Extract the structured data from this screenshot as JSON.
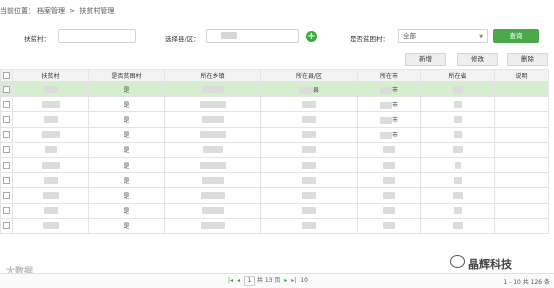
{
  "breadcrumb": {
    "prefix": "当前位置：",
    "item1": "档案管理",
    "sep": ">",
    "item2": "扶贫村管理"
  },
  "filters": {
    "village_label": "扶贫村：",
    "village_value": "",
    "county_label": "选择县/区：",
    "poor_label": "是否贫困村：",
    "poor_value": "全部",
    "search_label": "查询"
  },
  "toolbar": {
    "add": "新增",
    "edit": "修改",
    "delete": "删除"
  },
  "table": {
    "headers": [
      "扶贫村",
      "是否贫困村",
      "所在乡镇",
      "所在县/区",
      "所在市",
      "所在省",
      "说明"
    ],
    "rows": [
      {
        "poor": "是",
        "county_suffix": "县",
        "city_suffix": "市"
      },
      {
        "poor": "是",
        "county_suffix": "",
        "city_suffix": "市"
      },
      {
        "poor": "是",
        "county_suffix": "",
        "city_suffix": "市"
      },
      {
        "poor": "是",
        "county_suffix": "",
        "city_suffix": "市"
      },
      {
        "poor": "是",
        "county_suffix": "",
        "city_suffix": ""
      },
      {
        "poor": "是",
        "county_suffix": "",
        "city_suffix": ""
      },
      {
        "poor": "是",
        "county_suffix": "",
        "city_suffix": ""
      },
      {
        "poor": "是",
        "county_suffix": "",
        "city_suffix": ""
      },
      {
        "poor": "是",
        "county_suffix": "",
        "city_suffix": ""
      },
      {
        "poor": "是",
        "county_suffix": "",
        "city_suffix": ""
      }
    ]
  },
  "footer": {
    "page": "1",
    "total_pages": "共 13 页",
    "page_size": "10",
    "summary": "1 - 10 共 126 条"
  },
  "watermarks": {
    "left": "大数据",
    "right": "晶辉科技"
  },
  "colors": {
    "accent": "#4ba94b",
    "selected_row": "#d7edd0"
  }
}
